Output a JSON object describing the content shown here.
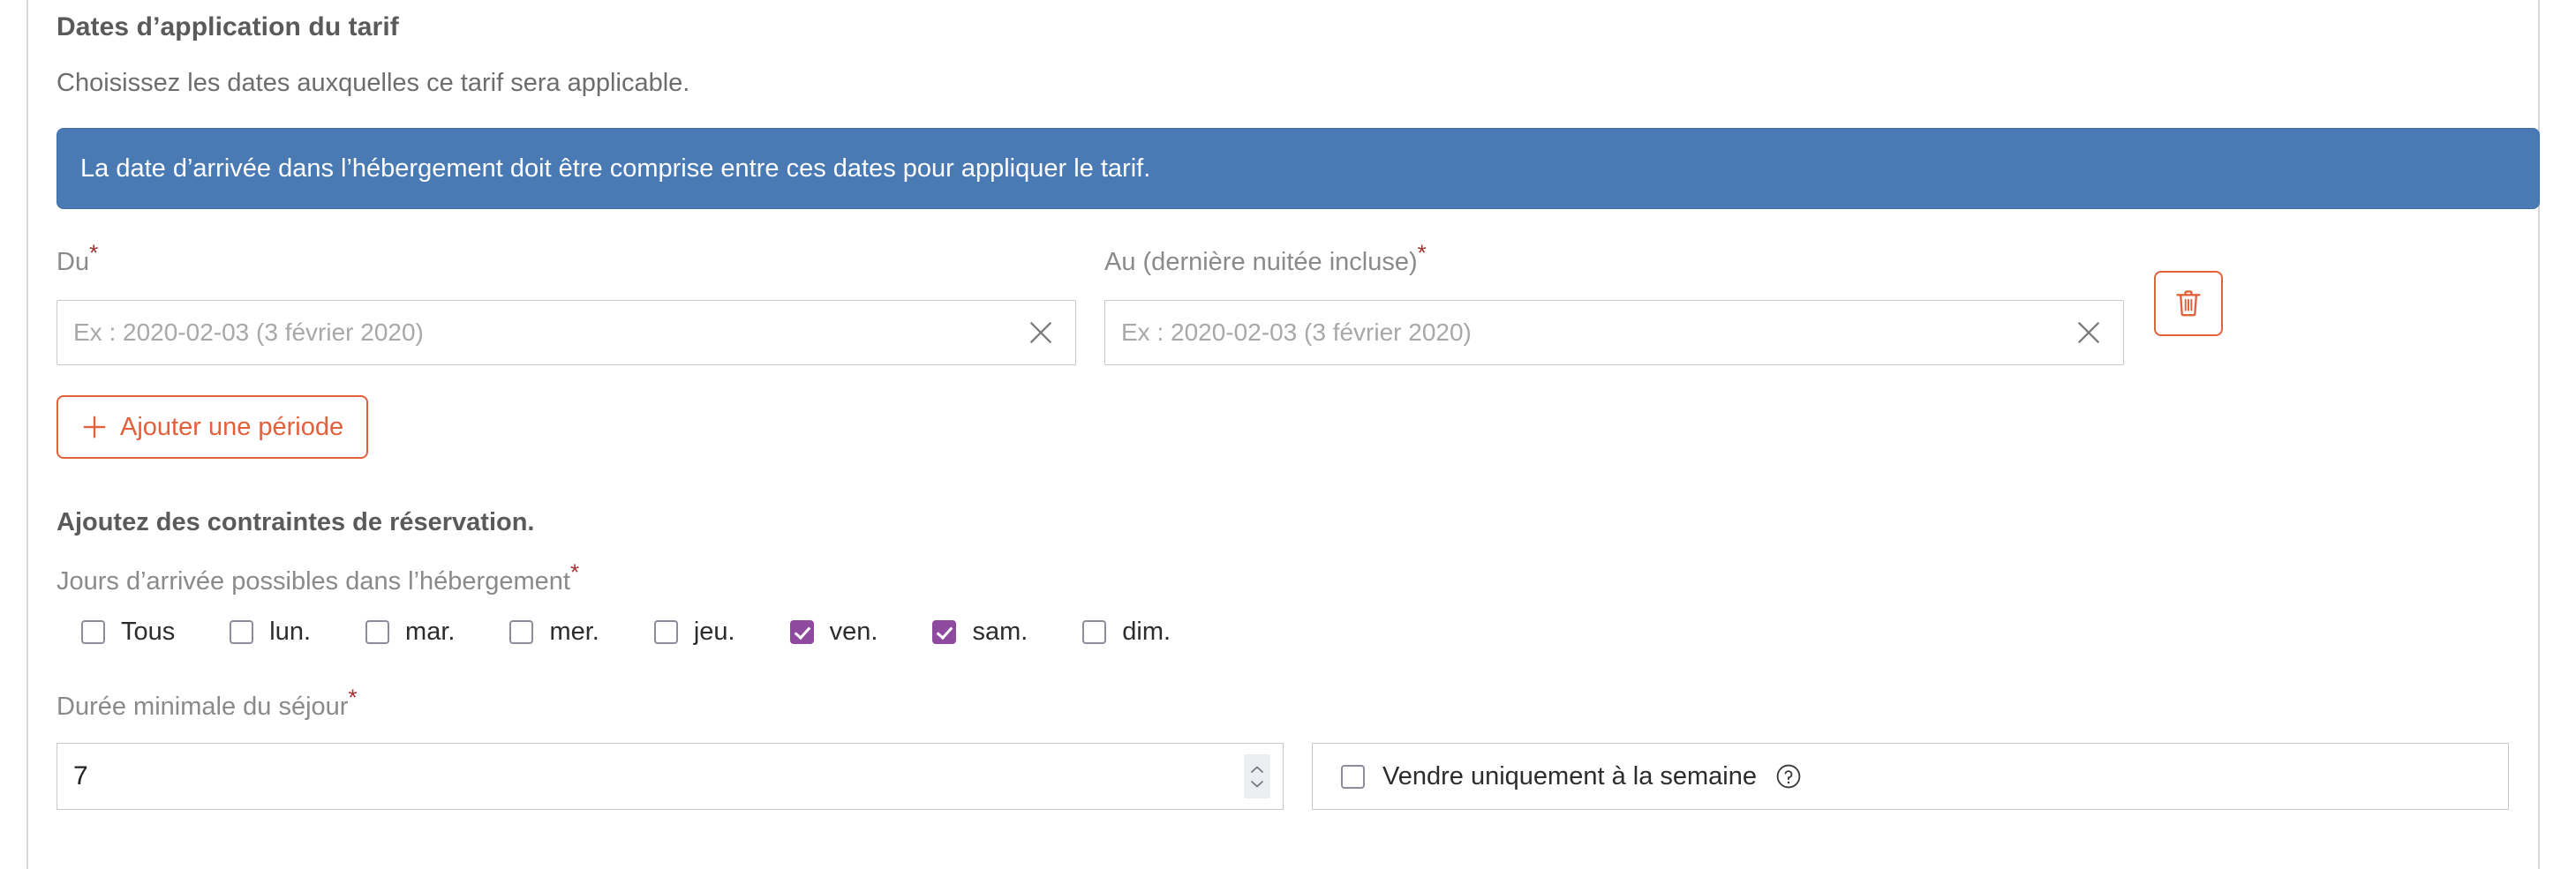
{
  "section": {
    "title": "Dates d’application du tarif",
    "subtitle": "Choisissez les dates auxquelles ce tarif sera applicable."
  },
  "banner": {
    "text": "La date d’arrivée dans l’hébergement doit être comprise entre ces dates pour appliquer le tarif.",
    "background_color": "#4a7ab3",
    "text_color": "#ffffff"
  },
  "period": {
    "from_label": "Du",
    "from_required": "*",
    "from_value": "",
    "from_placeholder": "Ex : 2020-02-03 (3 février 2020)",
    "to_label": "Au (dernière nuitée incluse)",
    "to_required": "*",
    "to_value": "",
    "to_placeholder": "Ex : 2020-02-03 (3 février 2020)",
    "clear_icon": "close-x-icon",
    "delete_icon": "trash-icon",
    "add_label": "Ajouter une période",
    "add_icon": "plus-icon",
    "accent_color": "#e2603a"
  },
  "constraints": {
    "title": "Ajoutez des contraintes de réservation.",
    "days_label": "Jours d’arrivée possibles dans l’hébergement",
    "days_required": "*",
    "checked_color": "#8e4a9e",
    "days": [
      {
        "name": "tous",
        "label": "Tous",
        "checked": false
      },
      {
        "name": "lundi",
        "label": "lun.",
        "checked": false
      },
      {
        "name": "mardi",
        "label": "mar.",
        "checked": false
      },
      {
        "name": "mercredi",
        "label": "mer.",
        "checked": false
      },
      {
        "name": "jeudi",
        "label": "jeu.",
        "checked": false
      },
      {
        "name": "vendredi",
        "label": "ven.",
        "checked": true
      },
      {
        "name": "samedi",
        "label": "sam.",
        "checked": true
      },
      {
        "name": "dimanche",
        "label": "dim.",
        "checked": false
      }
    ]
  },
  "duration": {
    "label": "Durée minimale du séjour",
    "required": "*",
    "value": "7",
    "spinner_icon": "stepper-arrows-icon",
    "week_only_label": "Vendre uniquement à la semaine",
    "week_only_checked": false,
    "help_icon": "question-mark-icon"
  },
  "required_marker_color": "#a33232"
}
